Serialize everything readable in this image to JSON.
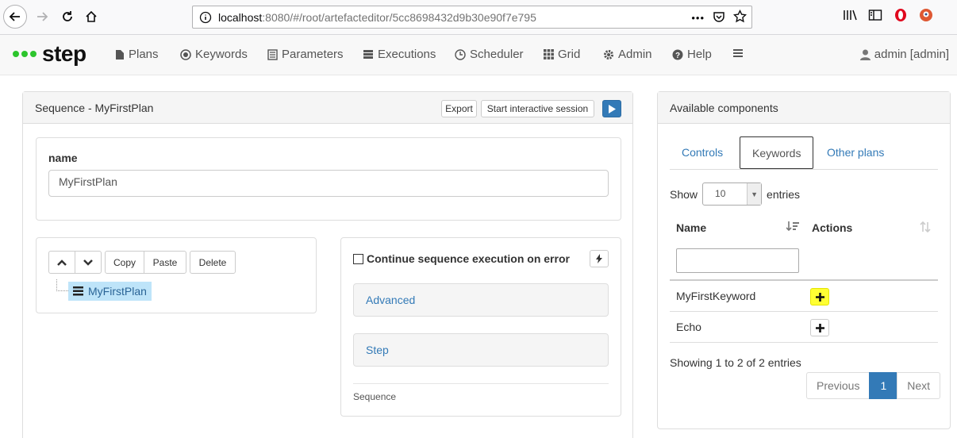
{
  "browser": {
    "url_host": "localhost",
    "url_rest": ":8080/#/root/artefacteditor/5cc8698432d9b30e90f7e795",
    "more_glyph": "•••"
  },
  "app": {
    "logo_text": "step",
    "nav": [
      "Plans",
      "Keywords",
      "Parameters",
      "Executions",
      "Scheduler",
      "Grid",
      "Admin",
      "Help"
    ],
    "user": "admin [admin]"
  },
  "editor": {
    "title": "Sequence - MyFirstPlan",
    "export_label": "Export",
    "interactive_label": "Start interactive session",
    "name_label": "name",
    "name_value": "MyFirstPlan",
    "tree_buttons": [
      "Copy",
      "Paste",
      "Delete"
    ],
    "tree_node": "MyFirstPlan",
    "continue_label": "Continue sequence execution on error",
    "sections": [
      "Advanced",
      "Step"
    ],
    "footer": "Sequence"
  },
  "components": {
    "title": "Available components",
    "tabs": [
      "Controls",
      "Keywords",
      "Other plans"
    ],
    "active_tab": "Keywords",
    "show_label": "Show",
    "entries_label": "entries",
    "page_size": "10",
    "col_name": "Name",
    "col_actions": "Actions",
    "rows": [
      {
        "name": "MyFirstKeyword",
        "highlighted": true
      },
      {
        "name": "Echo",
        "highlighted": false
      }
    ],
    "info": "Showing 1 to 2 of 2 entries",
    "pager": {
      "prev": "Previous",
      "current": "1",
      "next": "Next"
    }
  }
}
